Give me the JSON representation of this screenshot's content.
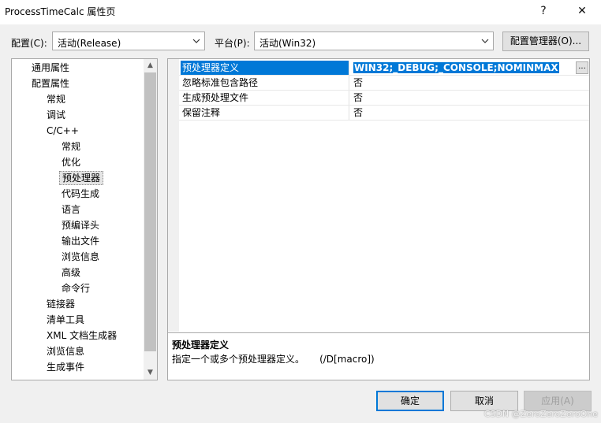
{
  "window": {
    "title": "ProcessTimeCalc 属性页",
    "help_label": "?",
    "close_label": "✕"
  },
  "config": {
    "config_label": "配置(C):",
    "config_value": "活动(Release)",
    "platform_label": "平台(P):",
    "platform_value": "活动(Win32)",
    "manager_button": "配置管理器(O)..."
  },
  "tree": {
    "items": [
      {
        "label": "通用属性"
      },
      {
        "label": "配置属性"
      },
      {
        "label": "常规"
      },
      {
        "label": "调试"
      },
      {
        "label": "C/C++"
      },
      {
        "label": "常规"
      },
      {
        "label": "优化"
      },
      {
        "label": "预处理器"
      },
      {
        "label": "代码生成"
      },
      {
        "label": "语言"
      },
      {
        "label": "预编译头"
      },
      {
        "label": "输出文件"
      },
      {
        "label": "浏览信息"
      },
      {
        "label": "高级"
      },
      {
        "label": "命令行"
      },
      {
        "label": "链接器"
      },
      {
        "label": "清单工具"
      },
      {
        "label": "XML 文档生成器"
      },
      {
        "label": "浏览信息"
      },
      {
        "label": "生成事件"
      }
    ]
  },
  "properties": {
    "rows": [
      {
        "name": "预处理器定义",
        "value": "WIN32;_DEBUG;_CONSOLE;NOMINMAX"
      },
      {
        "name": "忽略标准包含路径",
        "value": "否"
      },
      {
        "name": "生成预处理文件",
        "value": "否"
      },
      {
        "name": "保留注释",
        "value": "否"
      }
    ],
    "ellipsis": "..."
  },
  "description": {
    "title": "预处理器定义",
    "text": "指定一个或多个预处理器定义。     (/D[macro])"
  },
  "buttons": {
    "ok": "确定",
    "cancel": "取消",
    "apply": "应用(A)"
  },
  "watermark": "CSDN @ZeroZeroZeroOne"
}
